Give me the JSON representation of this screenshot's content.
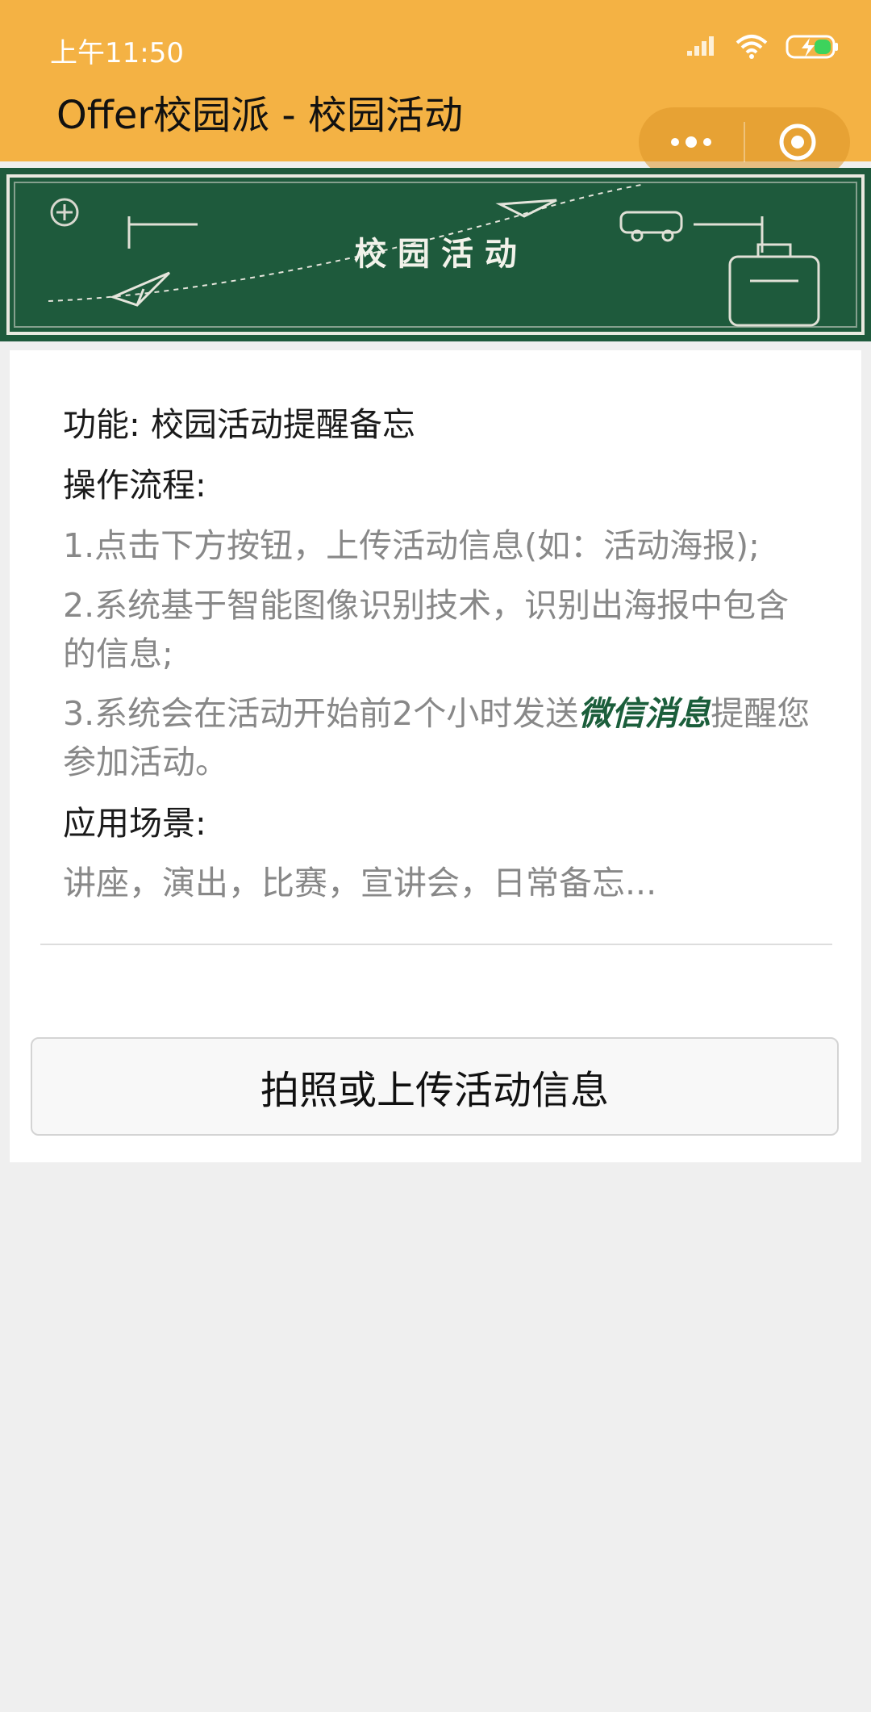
{
  "status_bar": {
    "time": "上午11:50",
    "icons": [
      "signal-icon",
      "wifi-icon",
      "battery-charging-icon"
    ]
  },
  "nav": {
    "title": "Offer校园派 - 校园活动",
    "capsule": [
      "more-dots-icon",
      "close-target-icon"
    ]
  },
  "banner": {
    "text": "校 园 活 动"
  },
  "content": {
    "feature": "功能: 校园活动提醒备忘",
    "process_heading": "操作流程:",
    "step1": "1.点击下方按钮，上传活动信息(如：活动海报);",
    "step2": "2.系统基于智能图像识别技术，识别出海报中包含的信息;",
    "step3_pre": "3.系统会在活动开始前2个小时发送",
    "step3_highlight": "微信消息",
    "step3_post": "提醒您参加活动。",
    "scenes_heading": "应用场景:",
    "scenes": "讲座，演出，比赛，宣讲会，日常备忘..."
  },
  "upload_button": {
    "label": "拍照或上传活动信息"
  },
  "colors": {
    "header_bg": "#f4b244",
    "banner_bg": "#1f5a3d",
    "highlight": "#1b5e3b",
    "page_bg": "#efefef"
  }
}
